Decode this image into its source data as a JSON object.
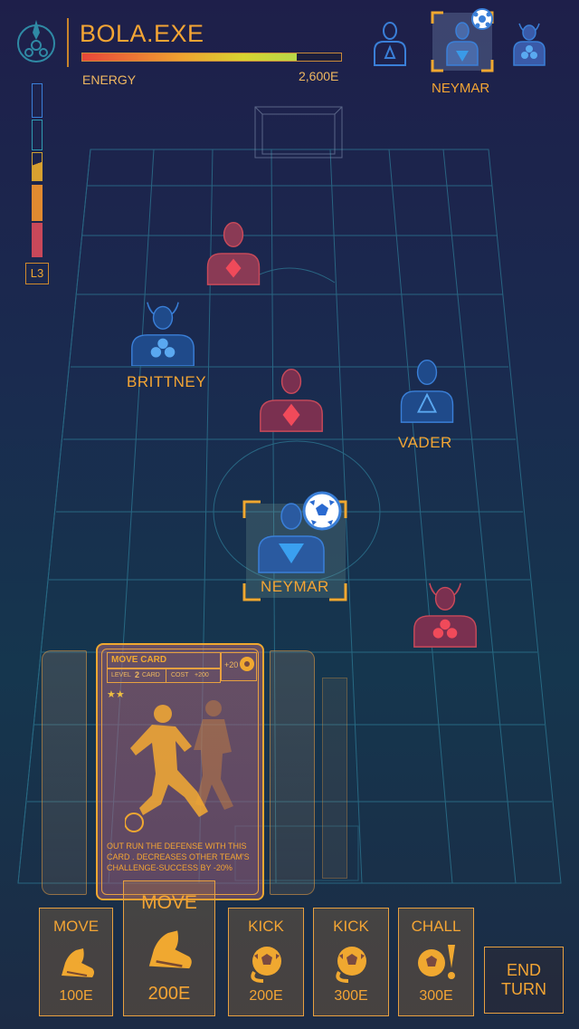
{
  "header": {
    "title": "BOLA.EXE",
    "energy_label": "ENERGY",
    "energy_value": "2,600E",
    "energy_fraction": 0.83,
    "selected_player_name": "NEYMAR"
  },
  "level": {
    "label": "L3",
    "segments_filled": 3,
    "segments_total": 6
  },
  "players": {
    "brittney": {
      "name": "BRITTNEY",
      "team": "blue",
      "suit": "club"
    },
    "vader": {
      "name": "VADER",
      "team": "blue",
      "suit": "spade"
    },
    "neymar": {
      "name": "NEYMAR",
      "team": "blue",
      "suit": "heart-inverted",
      "has_ball": true
    },
    "opponent_1": {
      "team": "red",
      "suit": "diamond"
    },
    "opponent_2": {
      "team": "red",
      "suit": "diamond"
    },
    "opponent_3": {
      "team": "red",
      "suit": "club"
    }
  },
  "card": {
    "title": "MOVE CARD",
    "bonus": "+20",
    "level_prefix": "LEVEL",
    "level_num": "2",
    "level_suffix": "CARD",
    "cost_label": "COST",
    "cost_value": "+200",
    "stars": "★★",
    "description": "OUT RUN THE DEFENSE WITH THIS CARD . DECREASES OTHER TEAM'S CHALLENGE-SUCCESS BY -20%"
  },
  "actions": [
    {
      "label": "MOVE",
      "cost": "100E",
      "icon": "boot-icon"
    },
    {
      "label": "MOVE",
      "cost": "200E",
      "icon": "boot-icon"
    },
    {
      "label": "KICK",
      "cost": "200E",
      "icon": "ball-icon"
    },
    {
      "label": "KICK",
      "cost": "300E",
      "icon": "ball-icon"
    },
    {
      "label": "CHALL",
      "cost": "300E",
      "icon": "ball-exclaim-icon"
    }
  ],
  "end_turn": {
    "line1": "END",
    "line2": "TURN"
  },
  "colors": {
    "accent": "#f4a534",
    "blue_team": "#3a7fd8",
    "red_team": "#c94a5a"
  }
}
